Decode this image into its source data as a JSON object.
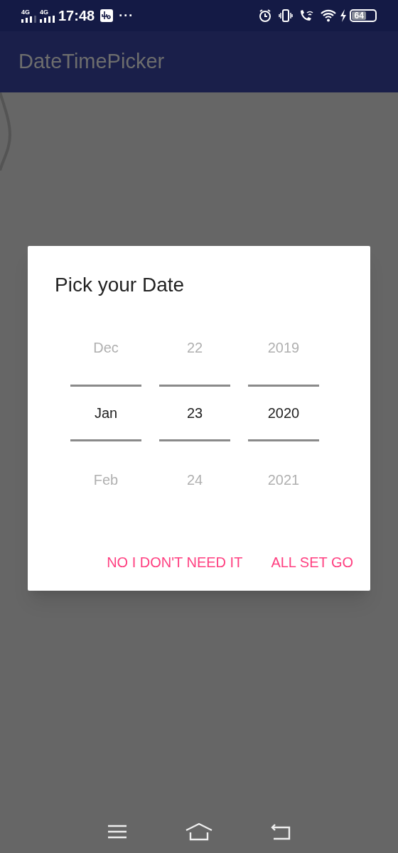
{
  "status_bar": {
    "networks": [
      "4G",
      "4G"
    ],
    "time": "17:48",
    "more": "···",
    "battery": "64"
  },
  "app_bar": {
    "title": "DateTimePicker"
  },
  "dialog": {
    "title": "Pick your Date",
    "columns": [
      {
        "items": [
          {
            "text": "Dec",
            "selected": false
          },
          {
            "text": "Jan",
            "selected": true
          },
          {
            "text": "Feb",
            "selected": false
          }
        ]
      },
      {
        "items": [
          {
            "text": "22",
            "selected": false
          },
          {
            "text": "23",
            "selected": true
          },
          {
            "text": "24",
            "selected": false
          }
        ]
      },
      {
        "items": [
          {
            "text": "2019",
            "selected": false
          },
          {
            "text": "2020",
            "selected": true
          },
          {
            "text": "2021",
            "selected": false
          }
        ]
      }
    ],
    "buttons": [
      "NO I DON'T NEED IT",
      "ALL SET GO"
    ]
  }
}
